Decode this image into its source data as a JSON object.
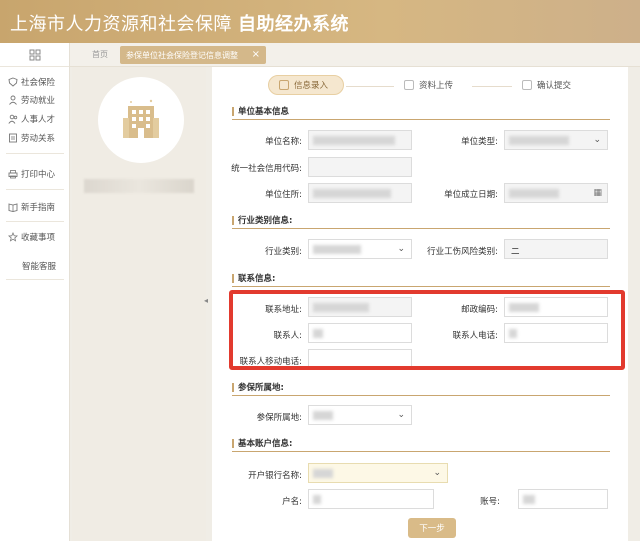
{
  "header": {
    "title_main": "上海市人力资源和社会保障",
    "title_bold": "自助经办系统"
  },
  "sidebar": {
    "items": [
      {
        "label": "社会保险",
        "icon": "shield-icon"
      },
      {
        "label": "劳动就业",
        "icon": "person-icon"
      },
      {
        "label": "人事人才",
        "icon": "people-icon"
      },
      {
        "label": "劳动关系",
        "icon": "document-icon"
      },
      {
        "label": "打印中心",
        "icon": "printer-icon"
      },
      {
        "label": "新手指南",
        "icon": "book-icon"
      },
      {
        "label": "收藏事项",
        "icon": "star-icon"
      },
      {
        "label": "智能客服",
        "icon": ""
      }
    ]
  },
  "tabs": {
    "home": "首页",
    "active": "参保单位社会保险登记信息调整",
    "close": "×"
  },
  "steps": [
    {
      "label": "信息录入"
    },
    {
      "label": "资料上传"
    },
    {
      "label": "确认提交"
    }
  ],
  "sections": {
    "basic": "单位基本信息",
    "industry": "行业类别信息:",
    "contact": "联系信息:",
    "location": "参保所属地:",
    "account": "基本账户信息:"
  },
  "fields": {
    "unit_name": "单位名称:",
    "unit_type": "单位类型:",
    "credit_code": "统一社会信用代码:",
    "address": "单位住所:",
    "founded": "单位成立日期:",
    "industry_type": "行业类别:",
    "risk_type": "行业工伤风险类别:",
    "risk_value": "二",
    "contact_addr": "联系地址:",
    "postcode": "邮政编码:",
    "contact_person": "联系人:",
    "contact_phone": "联系人电话:",
    "contact_mobile": "联系人移动电话:",
    "location": "参保所属地:",
    "bank": "开户银行名称:",
    "account_name": "户名:",
    "account_no": "账号:"
  },
  "next_button": "下一步",
  "colors": {
    "accent": "#c9a670",
    "highlight": "#e23a2e"
  }
}
